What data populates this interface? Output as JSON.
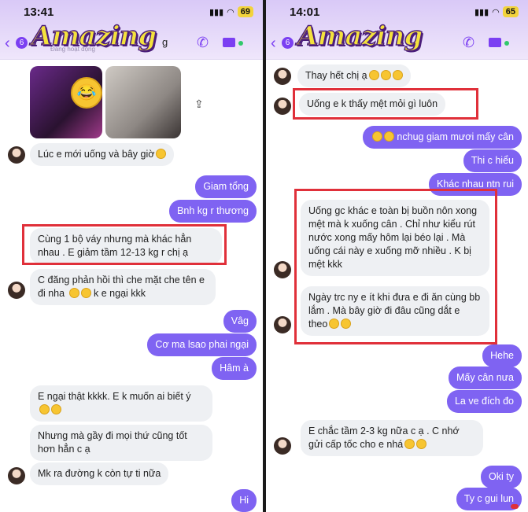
{
  "left": {
    "time": "13:41",
    "battery": "69",
    "badge": "6",
    "logo": "Amazing",
    "name_suffix": "g",
    "subtitle": "Đang hoạt động",
    "messages": {
      "m1": "Lúc e mới uống và bây giờ",
      "m2": "Giam tổng",
      "m3": "Bnh kg r thương",
      "m4": "Cùng 1 bộ váy nhưng mà khác hẳn nhau . E giảm tầm 12-13 kg r chị ạ",
      "m5": "C đăng phản hồi thì che mặt che tên e đi nha",
      "m5b": "k e ngại kkk",
      "m6": "Vâg",
      "m7": "Cơ ma lsao phai ngại",
      "m8": "Hâm à",
      "m9": "E ngại thật kkkk. E k muốn ai biết ý",
      "m10": "Nhưng mà gầy đi mọi thứ cũng tốt hơn hẳn c ạ",
      "m11": "Mk ra đường k còn tự ti nữa",
      "m12": "Hi"
    }
  },
  "right": {
    "time": "14:01",
    "battery": "65",
    "badge": "6",
    "logo": "Amazing",
    "messages": {
      "r1": "Thay hết chị ạ",
      "r2": "Uống e k thấy mệt mỏi gì luôn",
      "r3": "nchug giam mươi mấy cân",
      "r4": "Thi c hiểu",
      "r5": "Khác nhau ntn rui",
      "r6": "Uống gc khác e toàn bị buồn nôn xong mệt mà k xuống cân . Chỉ như kiểu rút nước xong mấy hôm lại béo lại . Mà uống cái này e xuống mỡ nhiều . K bị mệt kkk",
      "r7": "Ngày trc ny e ít khi đưa e đi ăn cùng bb lắm . Mà bây giờ đi đâu cũng dắt e theo",
      "r8": "Hehe",
      "r9": "Mấy cân nưa",
      "r10": "La ve đích đo",
      "r11": "E chắc tầm 2-3 kg nữa c ạ . C nhớ gửi cấp tốc cho e nhá",
      "r12": "Oki ty",
      "r13": "Ty c gui lun"
    }
  },
  "colors": {
    "outgoing": "#7f63f2",
    "incoming": "#eef0f3",
    "highlight": "#e0303a",
    "accent": "#7b3ff2"
  }
}
